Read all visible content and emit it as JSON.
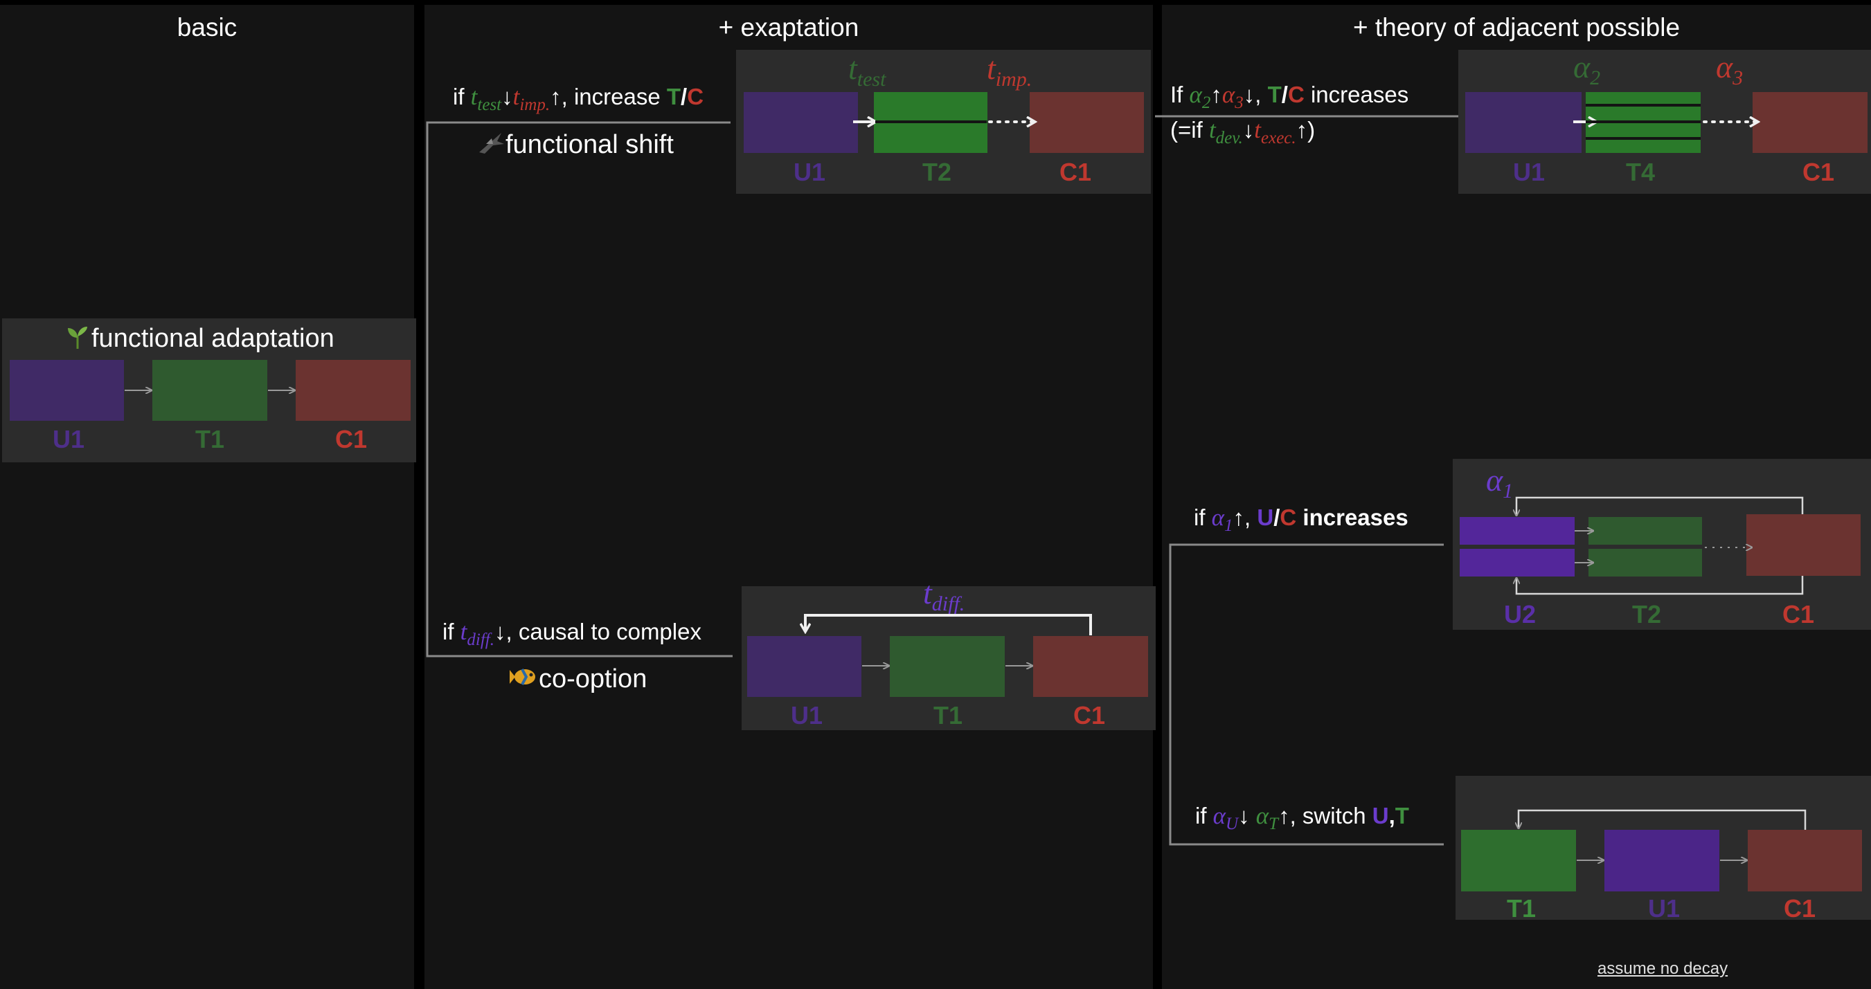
{
  "columns": {
    "basic": "basic",
    "exaptation": "+ exaptation",
    "adjacent": "+ theory of adjacent possible"
  },
  "functional_adaptation": {
    "title": "functional adaptation",
    "icon": "seedling-icon",
    "labels": [
      "U1",
      "T1",
      "C1"
    ]
  },
  "functional_shift": {
    "title": "functional shift",
    "icon": "bird-icon",
    "cond_pre": "if ",
    "cond_t1": "t",
    "cond_t1_sub": "test",
    "cond_arrow1": "↓",
    "cond_t2": "t",
    "cond_t2_sub": "imp.",
    "cond_arrow2": "↑",
    "cond_mid": ", increase ",
    "cond_T": "T",
    "cond_slash": "/",
    "cond_C": "C",
    "param1": "t",
    "param1_sub": "test",
    "param2": "t",
    "param2_sub": "imp.",
    "labels": [
      "U1",
      "T2",
      "C1"
    ]
  },
  "co_option": {
    "title": "co-option",
    "icon": "fish-icon",
    "cond_pre": "if ",
    "cond_t": "t",
    "cond_t_sub": "diff.",
    "cond_arrow": "↓",
    "cond_post": ", causal to complex",
    "param": "t",
    "param_sub": "diff.",
    "labels": [
      "U1",
      "T1",
      "C1"
    ]
  },
  "adj_top": {
    "line1_pre": "If ",
    "a2": "α",
    "a2_sub": "2",
    "arrow_up": "↑",
    "a3": "α",
    "a3_sub": "3",
    "arrow_down": "↓",
    "comma": ", ",
    "T": "T",
    "slash": "/",
    "C": "C",
    "line1_post": " increases",
    "line2_pre": "(=if ",
    "t_dev": "t",
    "t_dev_sub": "dev.",
    "l2_arrow1": "↓",
    "t_exec": "t",
    "t_exec_sub": "exec.",
    "l2_arrow2": "↑",
    "line2_post": ")",
    "param1": "α",
    "param1_sub": "2",
    "param2": "α",
    "param2_sub": "3",
    "labels": [
      "U1",
      "T4",
      "C1"
    ]
  },
  "adj_mid": {
    "cond_pre": "if ",
    "a1": "α",
    "a1_sub": "1",
    "arrow": "↑",
    "comma": ", ",
    "U": "U",
    "slash": "/",
    "C": "C",
    "post": " increases",
    "param": "α",
    "param_sub": "1",
    "labels": [
      "U2",
      "T2",
      "C1"
    ]
  },
  "adj_bot": {
    "cond_pre": "if ",
    "aU": "α",
    "aU_sub": "U",
    "arrow1": "↓",
    "aT": "α",
    "aT_sub": "T",
    "arrow2": "↑",
    "mid": ", switch ",
    "U": "U",
    "comma": ",",
    "T": "T",
    "labels": [
      "T1",
      "U1",
      "C1"
    ]
  },
  "footnote": "assume no decay",
  "colors": {
    "background": "#141414",
    "box": "#2c2c2c",
    "purple": "#402a66",
    "green": "#2f5a2f",
    "red": "#6b3330",
    "label_purple": "#4e2f8a",
    "label_green": "#356b35",
    "label_red": "#c0382f"
  }
}
